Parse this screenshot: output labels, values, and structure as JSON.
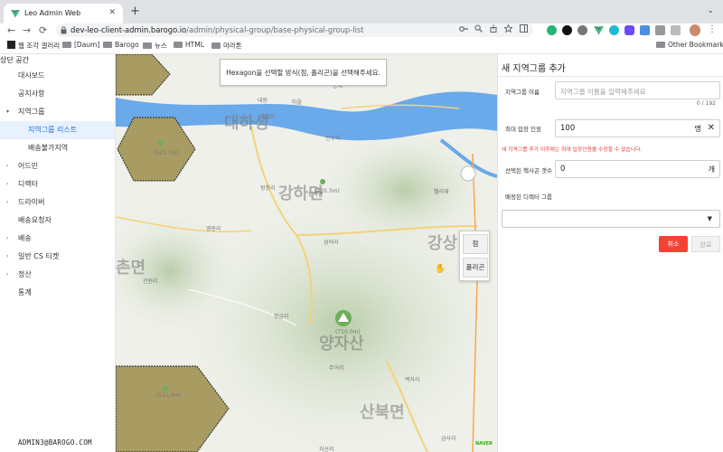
{
  "browser": {
    "tab_title": "Leo Admin Web",
    "tab_close": "✕",
    "new_tab": "+",
    "tab_menu": "⌄",
    "url_host": "dev-leo-client-admin.barogo.io",
    "url_path": "/admin/physical-group/base-physical-group-list",
    "back": "←",
    "forward": "→",
    "reload": "⟳",
    "kebab": "⋮"
  },
  "bookmarks": [
    {
      "label": "웹 조각 갤러리",
      "icon": "bookmark-logo"
    },
    {
      "label": "[Daum]",
      "icon": "folder"
    },
    {
      "label": "Barogo",
      "icon": "folder"
    },
    {
      "label": "뉴스",
      "icon": "folder"
    },
    {
      "label": "HTML",
      "icon": "folder"
    },
    {
      "label": "마라톤",
      "icon": "folder"
    }
  ],
  "other_bookmarks": "Other Bookmarks",
  "sidebar": {
    "header": "상단 공간",
    "items": [
      {
        "label": "대시보드",
        "arrow": ""
      },
      {
        "label": "공지사항",
        "arrow": ""
      },
      {
        "label": "지역그룹",
        "arrow": "▾"
      },
      {
        "label": "지역그룹 리스트",
        "arrow": ""
      },
      {
        "label": "배송불가지역",
        "arrow": ""
      },
      {
        "label": "어드민",
        "arrow": "›"
      },
      {
        "label": "디렉터",
        "arrow": "›"
      },
      {
        "label": "드라이버",
        "arrow": "›"
      },
      {
        "label": "배송요청자",
        "arrow": ""
      },
      {
        "label": "배송",
        "arrow": "›"
      },
      {
        "label": "일반 CS 티켓",
        "arrow": "›"
      },
      {
        "label": "정산",
        "arrow": "›"
      },
      {
        "label": "통계",
        "arrow": ""
      }
    ],
    "footer": "ADMIN3@BAROGO.COM"
  },
  "map": {
    "tooltip": "Hexagon을 선택할 방식(점, 폴리곤)을 선택해주세요.",
    "draw_point": "점",
    "draw_polygon": "폴리곤",
    "brand": "NAVER",
    "big_labels": [
      "대하성",
      "강하면",
      "양자산",
      "산북면",
      "강상",
      "촌면"
    ],
    "labels": [
      "대원",
      "마을",
      "강하면",
      "전수리",
      "왕창리",
      "성덕리",
      "항금리",
      "주어리",
      "백자리",
      "금사리",
      "지산리",
      "영동리",
      "관원리",
      "웰리재",
      "(527.7m)",
      "(205.3m)",
      "(710.0m)",
      "(531.4m)",
      "해들도",
      "능내"
    ],
    "cursor": "✋"
  },
  "panel": {
    "title": "새 지역그룹 추가",
    "name_label": "지역그룹 이름",
    "name_placeholder": "지역그룹 이름을 입력해주세요",
    "name_counter": "0 / 192",
    "max_label": "최대 입장 인원",
    "max_value": "100",
    "max_unit": "명",
    "max_clear": "✕",
    "warning": "새 지역그룹 추가 이후에는 최대 입장인원을 수정할 수 없습니다.",
    "hex_label": "선택된 헥사곤 갯수",
    "hex_value": "0",
    "hex_unit": "개",
    "director_label": "배정된 디렉터 그룹",
    "director_value": "",
    "cancel": "취소",
    "done": "완료"
  },
  "colors": {
    "accent": "#1f6fde",
    "active_bg": "#e8f1fe",
    "warning": "#e53935",
    "cancel_bg": "#f44336",
    "hexagon_fill": "#a89c63",
    "river": "#6aa9ea",
    "road_yellow": "#f4d27a"
  }
}
